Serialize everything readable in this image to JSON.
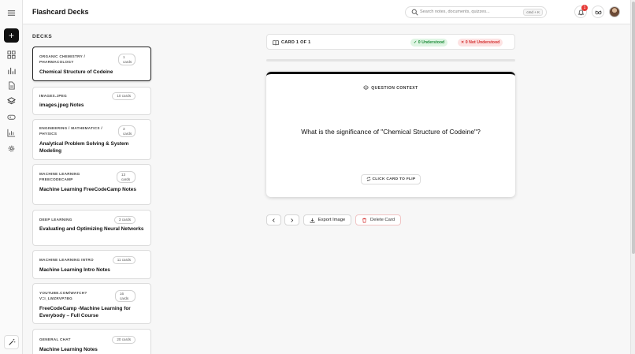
{
  "header": {
    "title": "Flashcard Decks",
    "search_placeholder": "Search notes, documents, quizzes...",
    "shortcut": "cmd + K",
    "notification_count": "1"
  },
  "decks_label": "DECKS",
  "decks": [
    {
      "category": "ORGANIC CHEMISTRY / PHARMACOLOGY",
      "count": "1 cards",
      "name": "Chemical Structure of Codeine",
      "active": true
    },
    {
      "category": "IMAGES.JPEG",
      "count": "10 cards",
      "name": "images.jpeg Notes"
    },
    {
      "category": "ENGINEERING / MATHEMATICS / PHYSICS",
      "count": "3 cards",
      "name": "Analytical Problem Solving & System Modeling"
    },
    {
      "category": "MACHINE LEARNING FREECODECAMP",
      "count": "13 cards",
      "name": "Machine Learning FreeCodeCamp Notes"
    },
    {
      "category": "DEEP LEARNING",
      "count": "3 cards",
      "name": "Evaluating and Optimizing Neural Networks"
    },
    {
      "category": "MACHINE LEARNING INTRO",
      "count": "11 cards",
      "name": "Machine Learning Intro Notes"
    },
    {
      "category": "YOUTUBE.COM/WATCH?V=I_LWZRVP7BG",
      "count": "16 cards",
      "name": "FreeCodeCamp -Machine Learning for Everybody – Full Course"
    },
    {
      "category": "GENERAL CHAT",
      "count": "20 cards",
      "name": "Machine Learning Notes"
    }
  ],
  "card": {
    "counter": "CARD 1 OF 1",
    "understood": "✓ 0 Understood",
    "not_understood": "✕ 0 Not Understood",
    "context_label": "QUESTION CONTEXT",
    "question": "What is the significance of \"Chemical Structure of Codeine\"?",
    "flip_label": "CLICK CARD TO FLIP",
    "progress": 0
  },
  "controls": {
    "export_label": "Export Image",
    "delete_label": "Delete Card"
  },
  "colors": {
    "accent": "#111111",
    "understood_bg": "#dff5e3",
    "understood_fg": "#1e8c3a",
    "not_understood_bg": "#fde2e2",
    "not_understood_fg": "#d32f2f"
  }
}
